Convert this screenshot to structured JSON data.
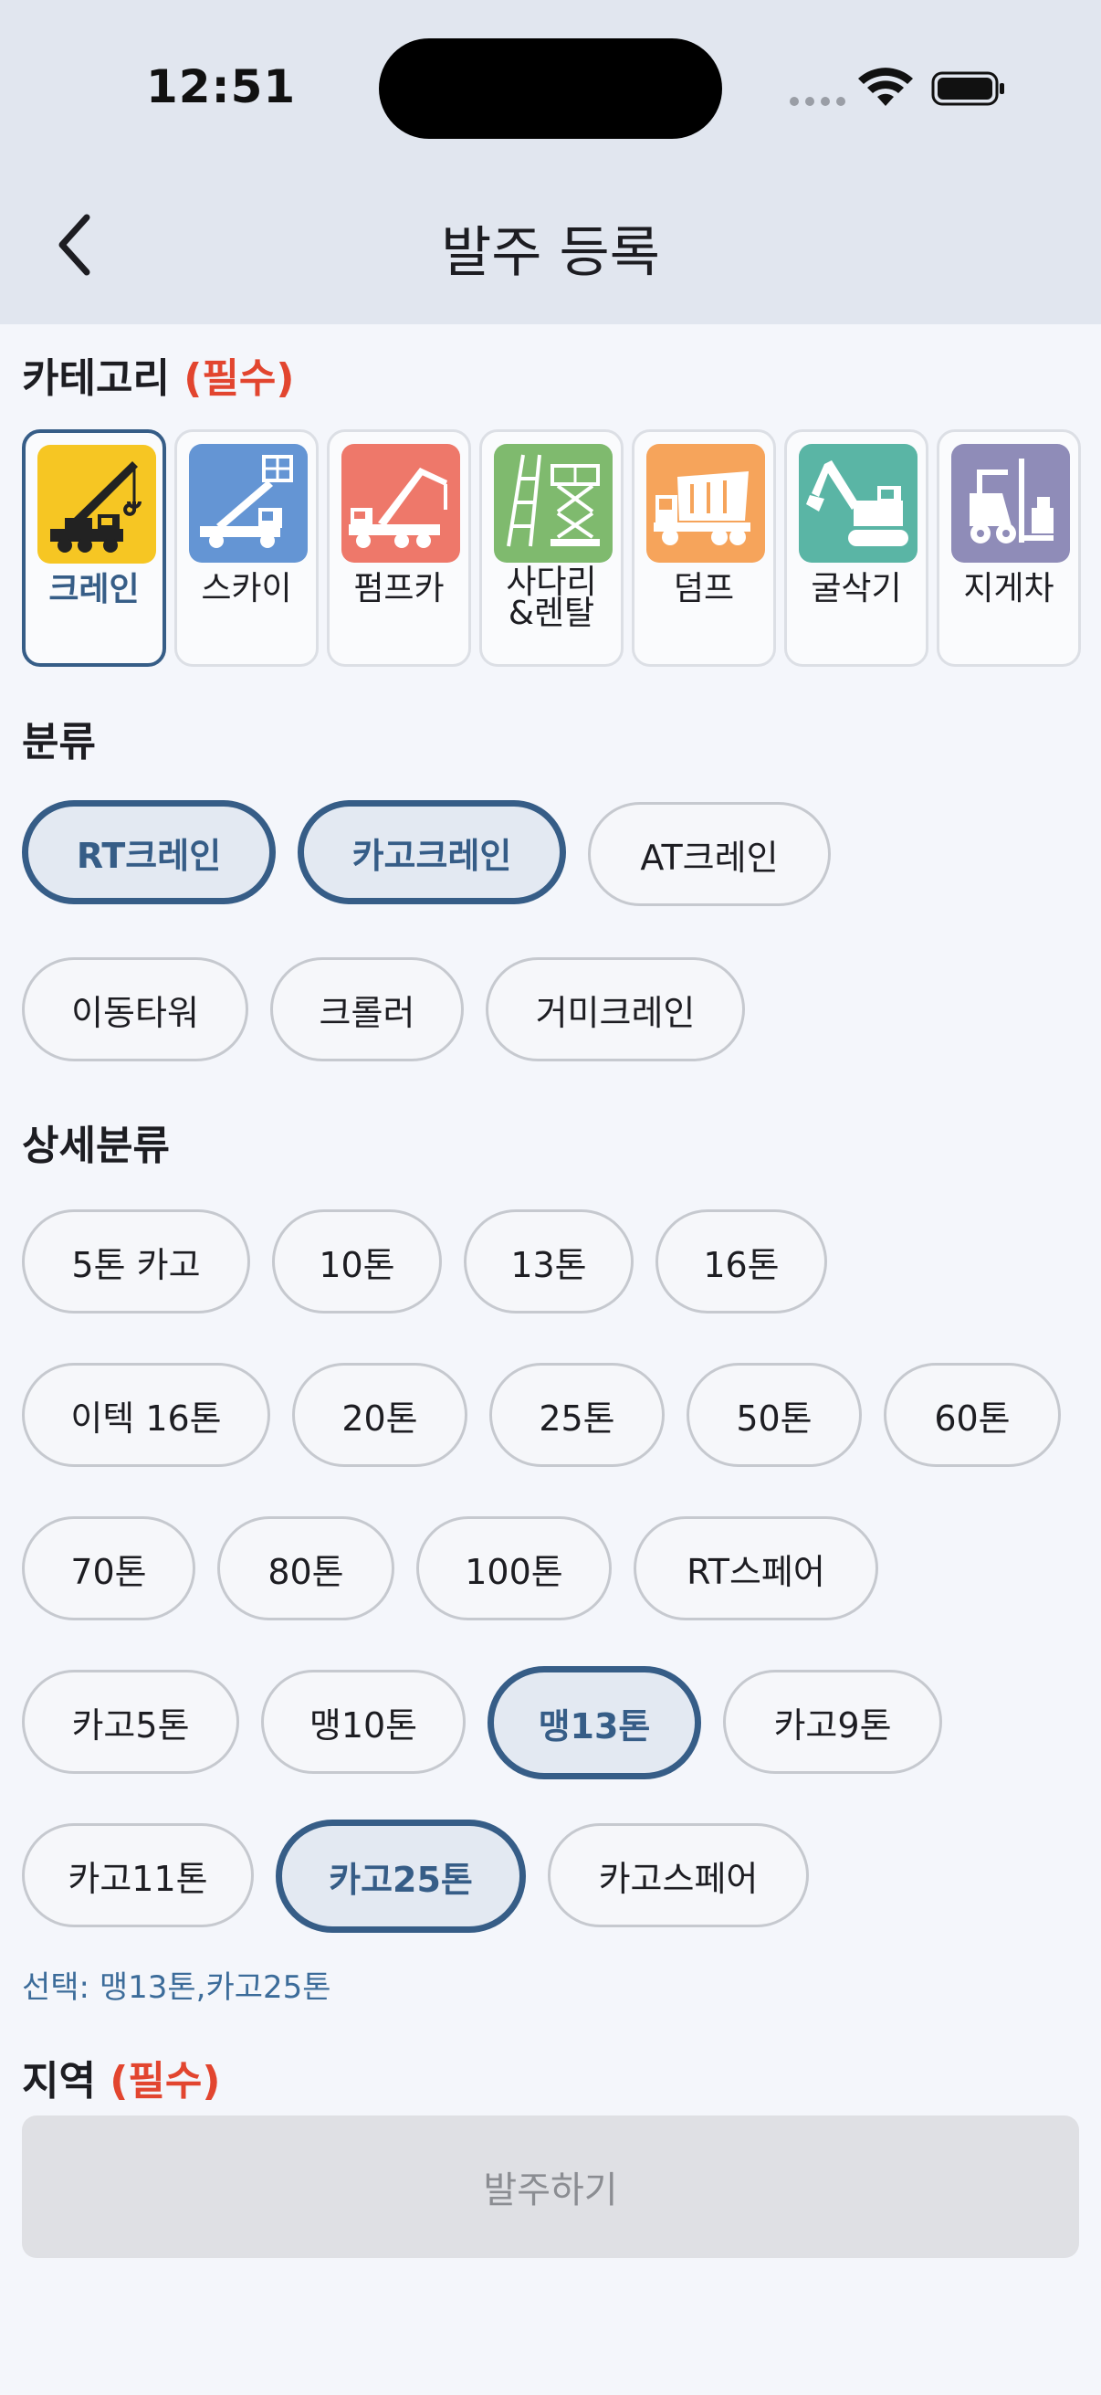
{
  "status_bar": {
    "time": "12:51"
  },
  "nav": {
    "title": "발주 등록"
  },
  "category": {
    "title": "카테고리",
    "required": "(필수)",
    "items": [
      {
        "label": "크레인",
        "icon": "crane-icon",
        "color": "#f6c623",
        "active": true
      },
      {
        "label": "스카이",
        "icon": "sky-lift-truck-icon",
        "color": "#6495d4",
        "active": false
      },
      {
        "label": "펌프카",
        "icon": "pump-truck-icon",
        "color": "#ee786a",
        "active": false
      },
      {
        "label": "사다리\n&렌탈",
        "icon": "ladder-scissor-lift-icon",
        "color": "#7fba6e",
        "active": false
      },
      {
        "label": "덤프",
        "icon": "dump-truck-icon",
        "color": "#f6a45b",
        "active": false
      },
      {
        "label": "굴삭기",
        "icon": "excavator-icon",
        "color": "#5ab5a5",
        "active": false
      },
      {
        "label": "지게차",
        "icon": "forklift-icon",
        "color": "#8f8cb8",
        "active": false
      }
    ]
  },
  "classification": {
    "title": "분류",
    "chips": [
      {
        "label": "RT크레인",
        "selected": true
      },
      {
        "label": "카고크레인",
        "selected": true
      },
      {
        "label": "AT크레인",
        "selected": false
      },
      {
        "label": "이동타워",
        "selected": false
      },
      {
        "label": "크롤러",
        "selected": false
      },
      {
        "label": "거미크레인",
        "selected": false
      }
    ]
  },
  "detail": {
    "title": "상세분류",
    "chips": [
      {
        "label": "5톤 카고",
        "selected": false
      },
      {
        "label": "10톤",
        "selected": false
      },
      {
        "label": "13톤",
        "selected": false
      },
      {
        "label": "16톤",
        "selected": false
      },
      {
        "label": "이텍 16톤",
        "selected": false
      },
      {
        "label": "20톤",
        "selected": false
      },
      {
        "label": "25톤",
        "selected": false
      },
      {
        "label": "50톤",
        "selected": false
      },
      {
        "label": "60톤",
        "selected": false
      },
      {
        "label": "70톤",
        "selected": false
      },
      {
        "label": "80톤",
        "selected": false
      },
      {
        "label": "100톤",
        "selected": false
      },
      {
        "label": "RT스페어",
        "selected": false
      },
      {
        "label": "카고5톤",
        "selected": false
      },
      {
        "label": "맹10톤",
        "selected": false
      },
      {
        "label": "맹13톤",
        "selected": true
      },
      {
        "label": "카고9톤",
        "selected": false
      },
      {
        "label": "카고11톤",
        "selected": false
      },
      {
        "label": "카고25톤",
        "selected": true
      },
      {
        "label": "카고스페어",
        "selected": false
      }
    ],
    "selection_text": "선택: 맹13톤,카고25톤"
  },
  "region": {
    "title": "지역",
    "required": "(필수)"
  },
  "order_button": {
    "label": "발주하기"
  },
  "colors": {
    "accent": "#365d87",
    "required": "#e2452f",
    "header_bg": "#e1e6ef",
    "page_bg": "#f4f6fb"
  }
}
